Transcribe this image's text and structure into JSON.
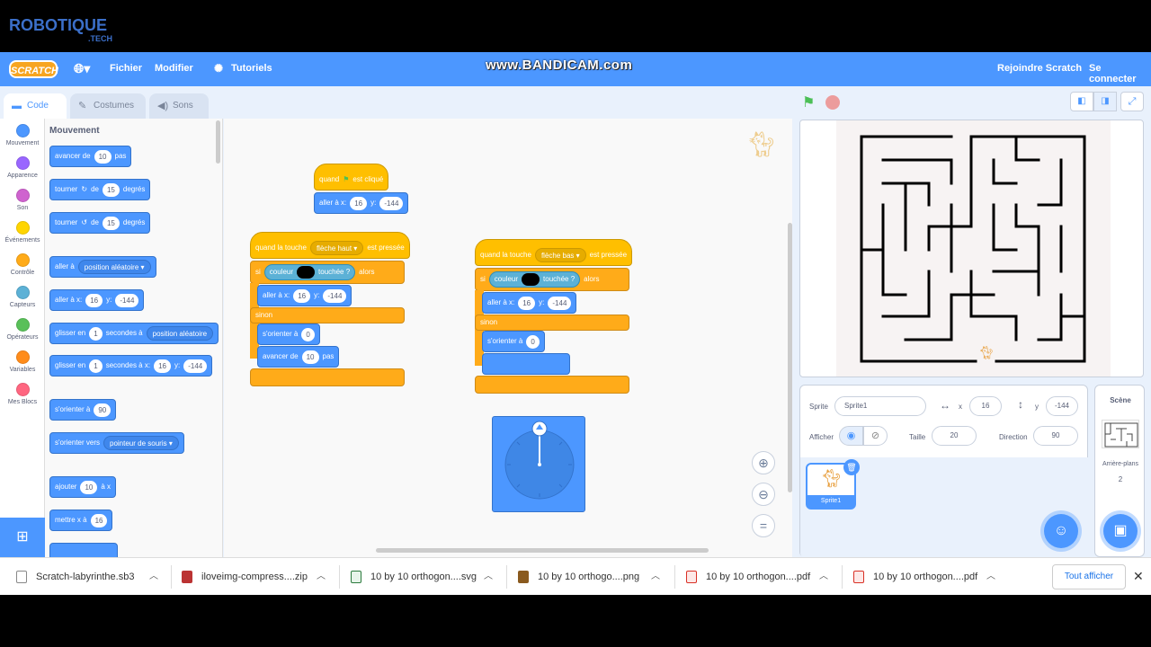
{
  "watermark": {
    "logo": "ROBOTIQUE",
    "logo_sub": ".TECH",
    "recorder": "www.BANDICAM.com"
  },
  "menubar": {
    "logo": "SCRATCH",
    "file": "Fichier",
    "edit": "Modifier",
    "tutorials": "Tutoriels",
    "join": "Rejoindre Scratch",
    "signin": "Se connecter"
  },
  "tabs": {
    "code": "Code",
    "costumes": "Costumes",
    "sounds": "Sons"
  },
  "categories": [
    {
      "label": "Mouvement",
      "color": "#4c97ff"
    },
    {
      "label": "Apparence",
      "color": "#9966ff"
    },
    {
      "label": "Son",
      "color": "#cf63cf"
    },
    {
      "label": "Événements",
      "color": "#ffd500"
    },
    {
      "label": "Contrôle",
      "color": "#ffab19"
    },
    {
      "label": "Capteurs",
      "color": "#5cb1d6"
    },
    {
      "label": "Opérateurs",
      "color": "#59c059"
    },
    {
      "label": "Variables",
      "color": "#ff8c1a"
    },
    {
      "label": "Mes Blocs",
      "color": "#ff6680"
    }
  ],
  "palette": {
    "title": "Mouvement",
    "move": {
      "a": "avancer de",
      "v": "10",
      "b": "pas"
    },
    "turn_right": {
      "a": "tourner",
      "b": "de",
      "v": "15",
      "c": "degrés"
    },
    "turn_left": {
      "a": "tourner",
      "b": "de",
      "v": "15",
      "c": "degrés"
    },
    "goto": {
      "a": "aller à",
      "dd": "position aléatoire"
    },
    "goto_xy": {
      "a": "aller à x:",
      "x": "16",
      "b": "y:",
      "y": "-144"
    },
    "glide": {
      "a": "glisser en",
      "v": "1",
      "b": "secondes à",
      "dd": "position aléatoire"
    },
    "glide_xy": {
      "a": "glisser en",
      "v": "1",
      "b": "secondes à x:",
      "x": "16",
      "c": "y:",
      "y": "-144"
    },
    "point": {
      "a": "s'orienter à",
      "v": "90"
    },
    "point_towards": {
      "a": "s'orienter vers",
      "dd": "pointeur de souris"
    },
    "change_x": {
      "a": "ajouter",
      "v": "10",
      "b": "à x"
    },
    "set_x": {
      "a": "mettre x à",
      "v": "16"
    }
  },
  "scripts": {
    "flag": {
      "when": "quand",
      "clicked": "est cliqué",
      "goto": "aller à x:",
      "x": "16",
      "y_label": "y:",
      "y": "-144"
    },
    "up": {
      "when": "quand la touche",
      "key": "flèche haut",
      "pressed": "est pressée",
      "if": "si",
      "color": "couleur",
      "touching": "touchée ?",
      "then": "alors",
      "goto": "aller à x:",
      "x": "16",
      "y_label": "y:",
      "y": "-144",
      "else": "sinon",
      "point": "s'orienter à",
      "dir": "0",
      "move": "avancer de",
      "steps": "10",
      "steps_label": "pas"
    },
    "down": {
      "when": "quand la touche",
      "key": "flèche bas",
      "pressed": "est pressée",
      "if": "si",
      "color": "couleur",
      "touching": "touchée ?",
      "then": "alors",
      "goto": "aller à x:",
      "x": "16",
      "y_label": "y:",
      "y": "-144",
      "else": "sinon",
      "point": "s'orienter à",
      "dir": "0"
    }
  },
  "sprite_info": {
    "sprite_label": "Sprite",
    "sprite_name": "Sprite1",
    "x_label": "x",
    "x": "16",
    "y_label": "y",
    "y": "-144",
    "show_label": "Afficher",
    "size_label": "Taille",
    "size": "20",
    "direction_label": "Direction",
    "direction": "90"
  },
  "sprite_tile": {
    "name": "Sprite1"
  },
  "stage_col": {
    "title": "Scène",
    "backdrops_label": "Arrière-plans",
    "backdrops_count": "2"
  },
  "downloads": [
    {
      "name": "Scratch-labyrinthe.sb3",
      "color": "#ffffff"
    },
    {
      "name": "iloveimg-compress....zip",
      "color": "#b33"
    },
    {
      "name": "10 by 10 orthogon....svg",
      "color": "#2b7a3d"
    },
    {
      "name": "10 by 10 orthogo....png",
      "color": "#8a5a1e"
    },
    {
      "name": "10 by 10 orthogon....pdf",
      "color": "#d93025"
    },
    {
      "name": "10 by 10 orthogon....pdf",
      "color": "#d93025"
    }
  ],
  "show_all": "Tout afficher"
}
